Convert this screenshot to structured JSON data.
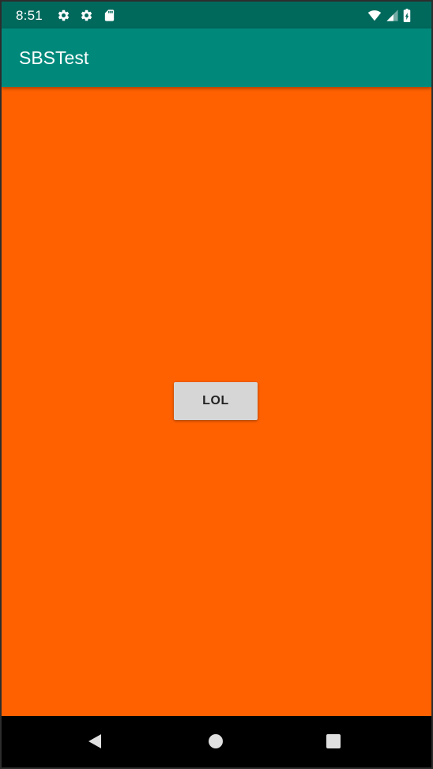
{
  "status_bar": {
    "time": "8:51",
    "background_color": "#00695c",
    "left_icons": [
      "gear-icon",
      "gear-icon",
      "sd-card-icon"
    ],
    "right_icons": [
      "wifi-icon",
      "signal-icon",
      "battery-charging-icon"
    ]
  },
  "app_bar": {
    "title": "SBSTest",
    "background_color": "#00897b"
  },
  "content": {
    "background_color": "#ff6100",
    "button_label": "LOL"
  },
  "nav_bar": {
    "buttons": [
      "back-icon",
      "home-icon",
      "recents-icon"
    ]
  }
}
